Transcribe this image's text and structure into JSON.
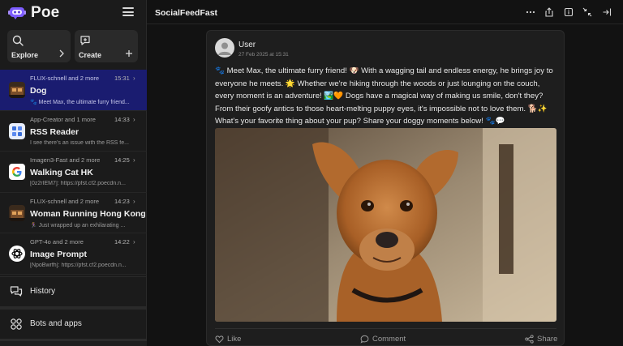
{
  "app": {
    "name": "Poe",
    "accent": "#1a1c70"
  },
  "sidebar": {
    "actions": [
      {
        "label": "Explore",
        "icon": "search-icon",
        "side_icon": "chevron-right-icon"
      },
      {
        "label": "Create",
        "icon": "chat-plus-icon",
        "side_icon": "plus-icon"
      }
    ],
    "chats": [
      {
        "meta": "FLUX-schnell and 2 more",
        "time": "15:31",
        "title": "Dog",
        "snippet": "🐾 Meet Max, the ultimate furry friend...",
        "active": true,
        "avatar_icon": "flux-avatar-icon"
      },
      {
        "meta": "App-Creator and 1 more",
        "time": "14:33",
        "title": "RSS Reader",
        "snippet": "I see there's an issue with the RSS fe...",
        "active": false,
        "avatar_icon": "app-creator-avatar-icon"
      },
      {
        "meta": "Imagen3-Fast and 2 more",
        "time": "14:25",
        "title": "Walking Cat HK",
        "snippet": "[0z2rIEM7]: https://pfst.cf2.poecdn.n...",
        "active": false,
        "avatar_icon": "google-avatar-icon"
      },
      {
        "meta": "FLUX-schnell and 2 more",
        "time": "14:23",
        "title": "Woman Running Hong Kong",
        "snippet": "🏃‍♀️ Just wrapped up an exhilarating ...",
        "active": false,
        "avatar_icon": "flux-avatar-icon"
      },
      {
        "meta": "GPT-4o and 2 more",
        "time": "14:22",
        "title": "Image Prompt",
        "snippet": "[NpoBwrfh]: https://pfst.cf2.poecdn.n...",
        "active": false,
        "avatar_icon": "openai-avatar-icon"
      }
    ],
    "history_label": "History",
    "bots_label": "Bots and apps"
  },
  "main": {
    "title": "SocialFeedFast",
    "message": {
      "author": "User",
      "timestamp": "27 Feb 2025 at 15:31",
      "text": "🐾 Meet Max, the ultimate furry friend! 🐶 With a wagging tail and endless energy, he brings joy to everyone he meets. 🌟 Whether we're hiking through the woods or just lounging on the couch, every moment is an adventure! 🏞️🧡 Dogs have a magical way of making us smile, don't they? From their goofy antics to those heart-melting puppy eyes, it's impossible not to love them. 🐕✨ What's your favorite thing about your pup? Share your doggy moments below! 🐾💬",
      "image_alt": "dog-photo",
      "actions": {
        "like": "Like",
        "comment": "Comment",
        "share": "Share"
      }
    }
  }
}
